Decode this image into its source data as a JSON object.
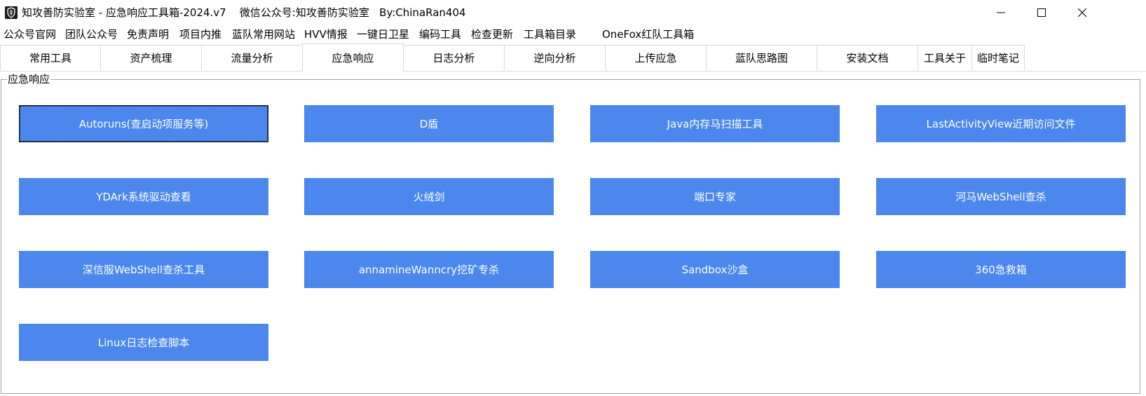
{
  "window": {
    "title": "知攻善防实验室 - 应急响应工具箱-2024.v7    微信公众号:知攻善防实验室   By:ChinaRan404",
    "icon": "app-logo-icon",
    "controls": [
      "minimize-icon",
      "maximize-icon",
      "close-icon"
    ]
  },
  "menu": {
    "items": [
      "公众号官网",
      "团队公众号",
      "免责声明",
      "项目内推",
      "蓝队常用网站",
      "HVV情报",
      "一键日卫星",
      "编码工具",
      "检查更新",
      "工具箱目录",
      "OneFox红队工具箱"
    ]
  },
  "tabs": {
    "items": [
      "常用工具",
      "资产梳理",
      "流量分析",
      "应急响应",
      "日志分析",
      "逆向分析",
      "上传应急",
      "蓝队思路图",
      "安装文档",
      "工具关于",
      "临时笔记"
    ],
    "active": "应急响应"
  },
  "group": {
    "label": "应急响应",
    "buttons": [
      "Autoruns(查启动项服务等)",
      "D盾",
      "Java内存马扫描工具",
      "LastActivityView近期访问文件",
      "YDArk系统驱动查看",
      "火绒剑",
      "端口专家",
      "河马WebShell查杀",
      "深信服WebShell查杀工具",
      "annamineWanncry挖矿专杀",
      "Sandbox沙盒",
      "360急救箱",
      "Linux日志检查脚本"
    ]
  },
  "colors": {
    "button_bg": "#4b87ec",
    "button_text": "#ffffff"
  }
}
